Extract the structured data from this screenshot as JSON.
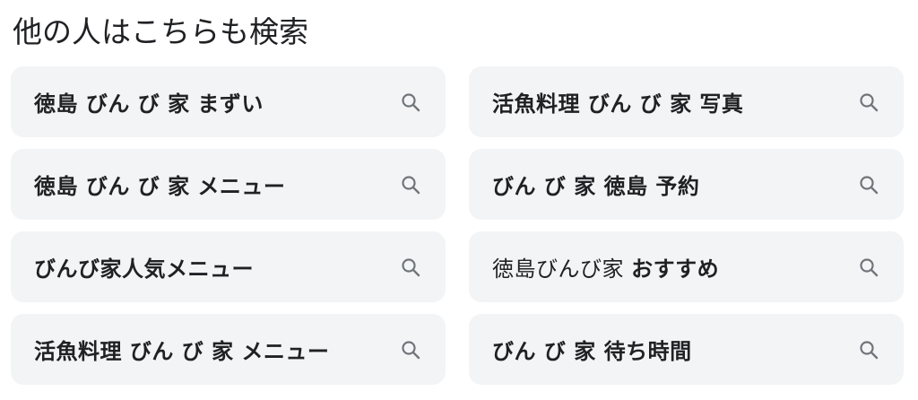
{
  "section": {
    "title": "他の人はこちらも検索"
  },
  "suggestions": [
    {
      "light": "",
      "bold": "徳島 びん び 家 まずい"
    },
    {
      "light": "",
      "bold": "活魚料理 びん び 家 写真"
    },
    {
      "light": "",
      "bold": "徳島 びん び 家 メニュー"
    },
    {
      "light": "",
      "bold": "びん び 家 徳島 予約"
    },
    {
      "light": "",
      "bold": "びんび家人気メニュー"
    },
    {
      "light": "徳島びんび家 ",
      "bold": "おすすめ"
    },
    {
      "light": "",
      "bold": "活魚料理 びん び 家 メニュー"
    },
    {
      "light": "",
      "bold": "びん び 家 待ち時間"
    }
  ],
  "icons": {
    "search": "search-icon"
  },
  "colors": {
    "chip_background": "#f3f4f6",
    "text": "#202124",
    "icon": "#70757a"
  }
}
